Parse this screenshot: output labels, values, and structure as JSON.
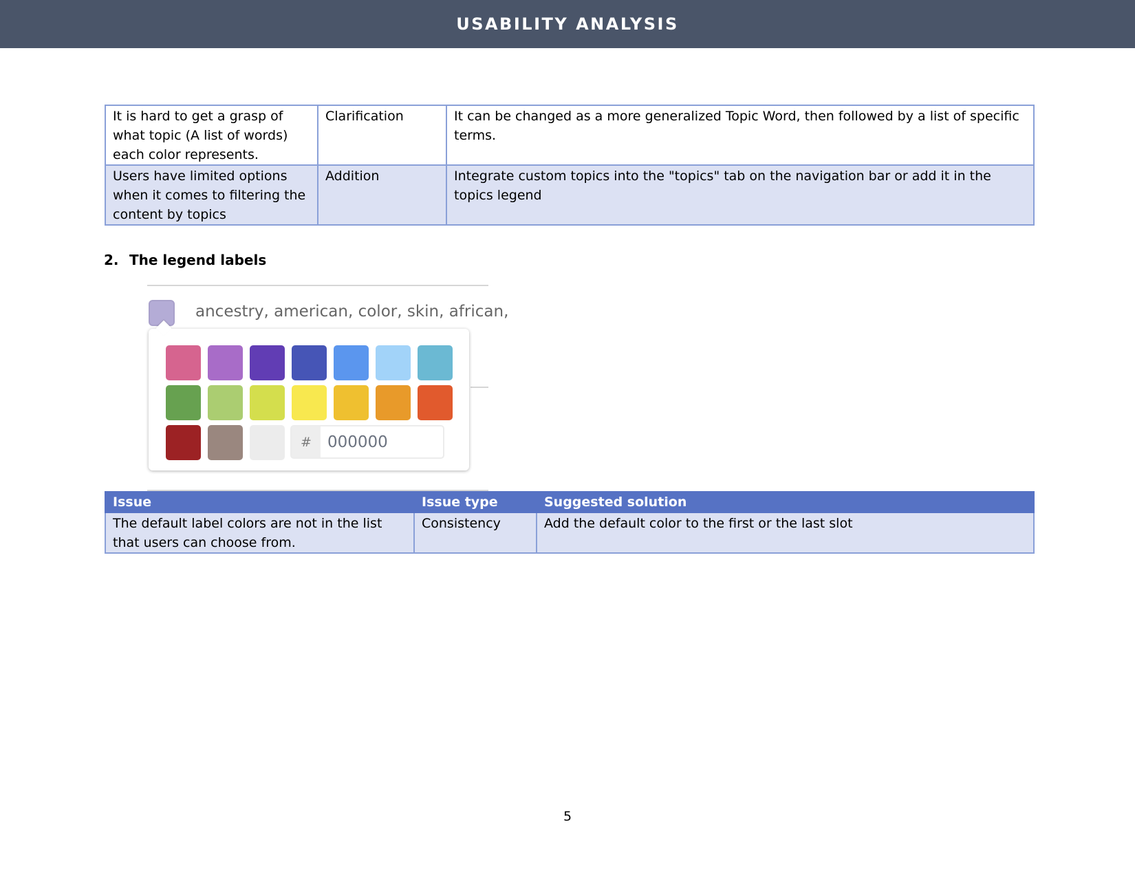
{
  "header": {
    "title": "USABILITY ANALYSIS"
  },
  "table1": {
    "rows": [
      {
        "issue": "It is hard to get a grasp of what topic (A list of words) each color represents.",
        "type": "Clarification",
        "solution": "It can be changed as a more generalized Topic Word, then followed by a list of specific terms."
      },
      {
        "issue": "Users have limited options when it comes to filtering the content by topics",
        "type": "Addition",
        "solution": "Integrate custom topics into the \"topics\" tab on the navigation bar or add it in the topics legend"
      }
    ]
  },
  "section": {
    "number": "2.",
    "title": "The legend labels"
  },
  "figure": {
    "legend_text": "ancestry, american, color, skin, african,",
    "current_swatch_color": "#b4acd6",
    "palette": [
      [
        "#d6648f",
        "#a86cc8",
        "#613db4",
        "#4655b6",
        "#5b96ee",
        "#a2d3f9",
        "#6bb9d3"
      ],
      [
        "#67a150",
        "#abcd71",
        "#d4de4d",
        "#f8e84f",
        "#efc030",
        "#e89a2a",
        "#e15a2d"
      ],
      [
        "#9c2224",
        "#9a877f",
        "#ececec"
      ]
    ],
    "hex_prefix": "#",
    "hex_value": "000000"
  },
  "table2": {
    "headers": [
      "Issue",
      "Issue type",
      "Suggested solution"
    ],
    "rows": [
      {
        "issue": "The default label colors are not in the list that users can choose from.",
        "type": "Consistency",
        "solution": "Add the default color to the first or the last slot"
      }
    ]
  },
  "page_number": "5"
}
